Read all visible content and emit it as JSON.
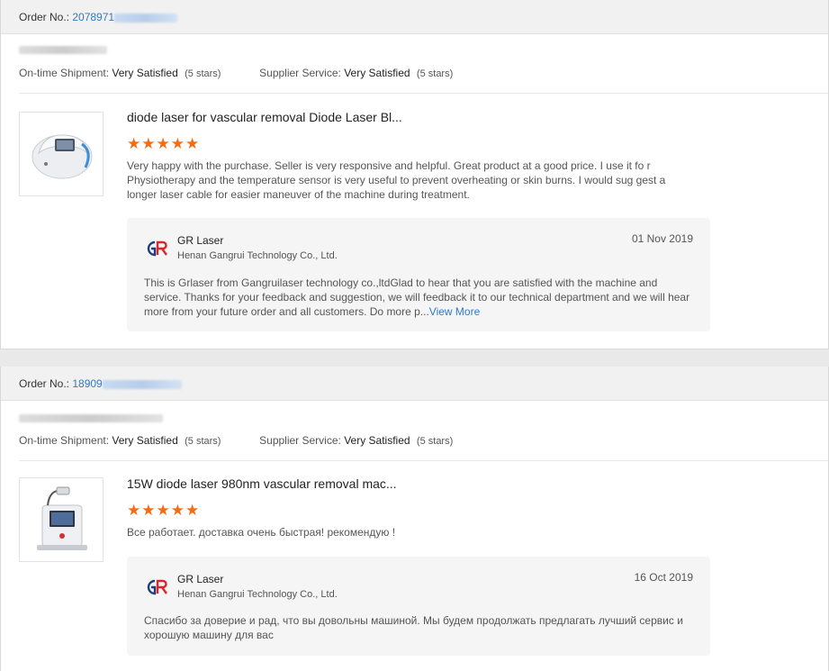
{
  "orders": [
    {
      "order_label": "Order No.:",
      "order_number": "2078971",
      "ontime_label": "On-time Shipment:",
      "ontime_value": "Very Satisfied",
      "ontime_stars": "(5 stars)",
      "supplier_label": "Supplier Service:",
      "supplier_value": "Very Satisfied",
      "supplier_stars": "(5 stars)",
      "product_title": "diode laser for vascular removal Diode Laser Bl...",
      "rating": 5,
      "review_text": "Very happy with the purchase. Seller is very responsive and helpful. Great product at a good price. I use it fo r Physiotherapy and the temperature sensor is very useful to prevent overheating or skin burns.  I would sug gest a longer laser cable for easier maneuver of the machine during treatment.",
      "reply_name": "GR Laser",
      "reply_company": "Henan Gangrui Technology Co., Ltd.",
      "reply_date": "01 Nov 2019",
      "reply_text": "This is Grlaser from Gangruilaser technology co.,ltdGlad to hear that you are satisfied with the machine and service. Thanks for your feedback and suggestion, we will feedback it to our technical department and we will hear more from your future order and all customers. Do more p...",
      "reply_more": "View More"
    },
    {
      "order_label": "Order No.:",
      "order_number": "18909",
      "ontime_label": "On-time Shipment:",
      "ontime_value": "Very Satisfied",
      "ontime_stars": "(5 stars)",
      "supplier_label": "Supplier Service:",
      "supplier_value": "Very Satisfied",
      "supplier_stars": "(5 stars)",
      "product_title": "15W diode laser 980nm vascular removal mac...",
      "rating": 5,
      "review_text": "Все работает. доставка очень быстрая! рекомендую !",
      "reply_name": "GR Laser",
      "reply_company": "Henan Gangrui Technology Co., Ltd.",
      "reply_date": "16 Oct 2019",
      "reply_text": "Спасибо за доверие и рад, что вы довольны машиной. Мы будем продолжать предлагать лучший сервис и хорошую машину для вас",
      "reply_more": ""
    }
  ],
  "icons": {
    "star": "star-icon",
    "logo": "gr-laser-logo"
  },
  "colors": {
    "link": "#2f7ac7",
    "star": "#f46c16",
    "logo_red": "#d9262c",
    "logo_blue": "#1f3e7a"
  }
}
